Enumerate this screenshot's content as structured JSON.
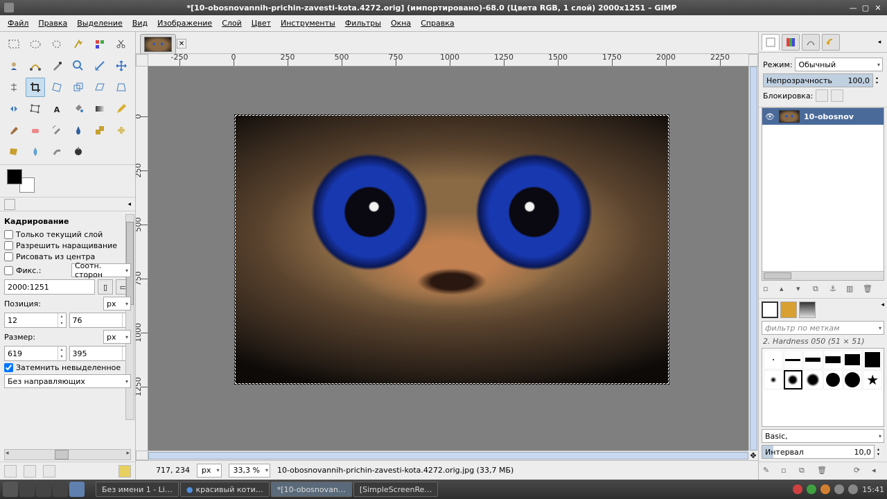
{
  "titlebar": {
    "title": "*[10-obosnovannih-prichin-zavesti-kota.4272.orig] (импортировано)-68.0 (Цвета RGB, 1 слой) 2000x1251 – GIMP"
  },
  "menu": {
    "file": "Файл",
    "edit": "Правка",
    "select": "Выделение",
    "view": "Вид",
    "image": "Изображение",
    "layer": "Слой",
    "colors": "Цвет",
    "tools": "Инструменты",
    "filters": "Фильтры",
    "windows": "Окна",
    "help": "Справка"
  },
  "tooloptions": {
    "title": "Кадрирование",
    "current_layer_only": "Только текущий слой",
    "allow_growing": "Разрешить наращивание",
    "expand_from_center": "Рисовать из центра",
    "fixed_label": "Фикс.:",
    "fixed_mode": "Соотн. сторон",
    "aspect": "2000:1251",
    "position_label": "Позиция:",
    "pos_x": "12",
    "pos_y": "76",
    "size_label": "Размер:",
    "size_w": "619",
    "size_h": "395",
    "unit": "px",
    "darken": "Затемнить невыделенное",
    "guides": "Без направляющих"
  },
  "ruler": {
    "h": [
      "-250",
      "0",
      "250",
      "500",
      "750",
      "1000",
      "1250",
      "1500",
      "1750",
      "2000",
      "2250"
    ],
    "v": [
      "0",
      "250",
      "500",
      "750",
      "1000",
      "1250"
    ]
  },
  "status": {
    "coords": "717, 234",
    "unit": "px",
    "zoom": "33,3 %",
    "file": "10-obosnovannih-prichin-zavesti-kota.4272.orig.jpg (33,7 МБ)"
  },
  "layers": {
    "mode_label": "Режим:",
    "mode": "Обычный",
    "opacity_label": "Непрозрачность",
    "opacity": "100,0",
    "lock_label": "Блокировка:",
    "layer_name": "10-obosnov"
  },
  "brushes": {
    "filter_placeholder": "фильтр по меткам",
    "selected": "2. Hardness 050 (51 × 51)",
    "preset": "Basic,",
    "spacing_label": "Интервал",
    "spacing": "10,0"
  },
  "taskbar": {
    "items": [
      "Без имени 1 - Li…",
      "красивый коти…",
      "*[10-obosnovan…",
      "[SimpleScreenRe…"
    ],
    "time": "15:41"
  }
}
